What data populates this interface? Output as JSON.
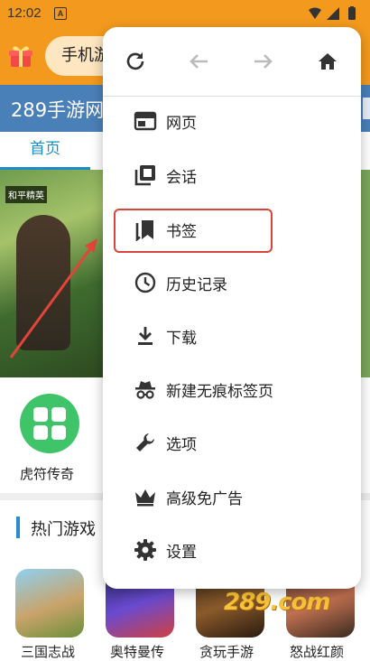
{
  "status_bar": {
    "time": "12:02",
    "app_badge": "A"
  },
  "browser": {
    "url_text": "手机游"
  },
  "site": {
    "title": "289手游网",
    "tab_home": "首页"
  },
  "banner": {
    "game_logo": "和平精英"
  },
  "apps": [
    {
      "label": "虎符传奇"
    }
  ],
  "section": {
    "title": "热门游戏"
  },
  "games": [
    {
      "label": "三国志战"
    },
    {
      "label": "奥特曼传"
    },
    {
      "label": "贪玩手游"
    },
    {
      "label": "怒战红颜"
    }
  ],
  "watermark": "289.com",
  "menu": {
    "items": [
      {
        "label": "网页",
        "icon": "tab-icon"
      },
      {
        "label": "会话",
        "icon": "session-icon"
      },
      {
        "label": "书签",
        "icon": "bookmark-icon",
        "highlighted": true
      },
      {
        "label": "历史记录",
        "icon": "clock-icon"
      },
      {
        "label": "下载",
        "icon": "download-icon"
      },
      {
        "label": "新建无痕标签页",
        "icon": "incognito-icon"
      },
      {
        "label": "选项",
        "icon": "wrench-icon"
      },
      {
        "label": "高级免广告",
        "icon": "crown-icon"
      },
      {
        "label": "设置",
        "icon": "gear-icon"
      }
    ]
  },
  "colors": {
    "toolbar": "#f39a1e",
    "site_header": "#4a80b8",
    "accent": "#1a8cc8",
    "highlight_border": "#d9453a",
    "app_green": "#40c46a"
  }
}
